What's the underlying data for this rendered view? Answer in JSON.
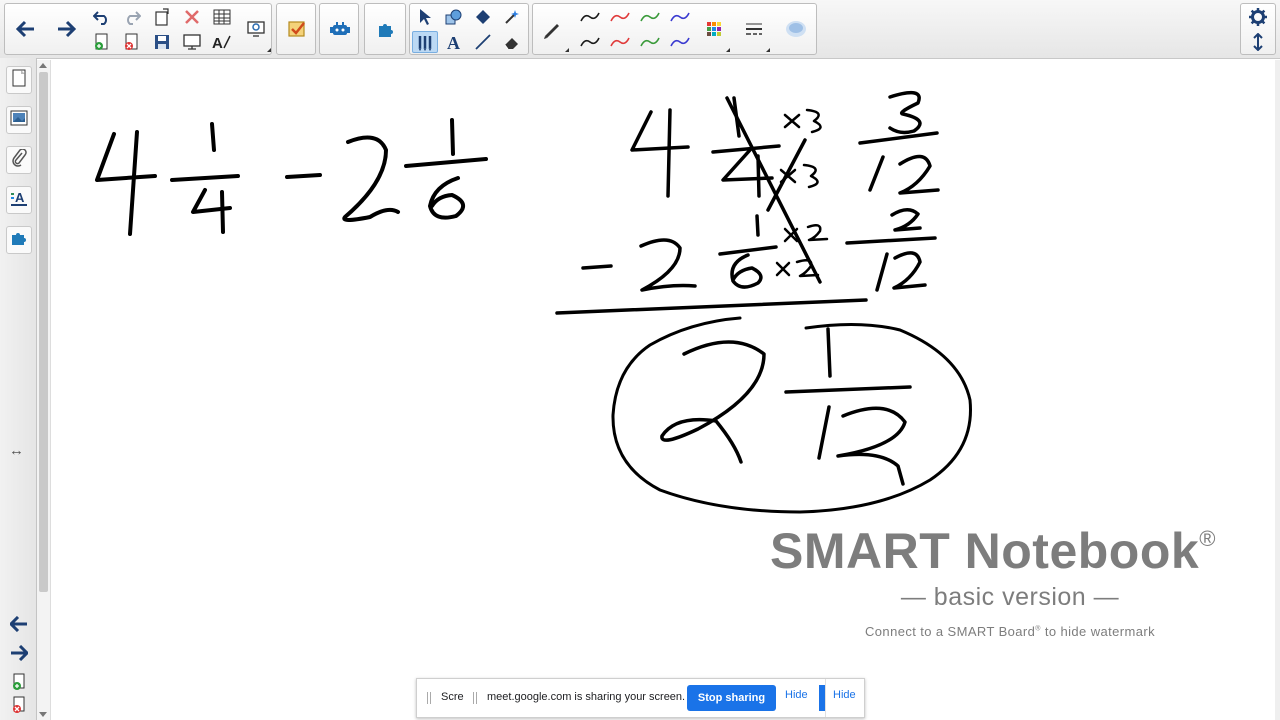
{
  "app": {
    "name": "SMART Notebook",
    "accent": "#1a73e8",
    "ink_color": "#000000"
  },
  "toolbar": {
    "icons": [
      "back-arrow-icon",
      "forward-arrow-icon",
      "undo-icon",
      "redo-icon",
      "new-page-icon",
      "delete-icon",
      "table-icon",
      "add-page-icon",
      "delete-page-icon",
      "save-icon",
      "screen-shade-icon",
      "handwriting-recognition-icon",
      "capture-icon",
      "response-icon",
      "add-on-icon",
      "lab-icon",
      "select-icon",
      "shape-icon",
      "fill-icon",
      "magic-pen-icon",
      "pen-tool-icon",
      "text-icon",
      "line-icon",
      "eraser-icon",
      "pen-icon",
      "color-palette-icon",
      "line-style-icon",
      "properties-icon",
      "settings-gear-icon",
      "toolbar-position-icon"
    ],
    "pen_swatches": [
      "#1a1a1a",
      "#e03a3a",
      "#3a9a3a",
      "#3a3ad0"
    ]
  },
  "sidebar": {
    "icons": [
      "page-sorter-icon",
      "gallery-icon",
      "attachments-icon",
      "properties-icon",
      "add-ons-icon"
    ],
    "bottom_icons": [
      "previous-page-icon",
      "next-page-icon",
      "add-page-icon",
      "delete-page-icon"
    ],
    "resize_glyph": "↔"
  },
  "watermark": {
    "title": "SMART Notebook",
    "registered": "®",
    "subtitle": "— basic version —",
    "note_before": "Connect to a SMART Board",
    "note_reg": "®",
    "note_after": " to hide watermark"
  },
  "share_bar": {
    "underlying_text": "Scre",
    "message": "meet.google.com is sharing your screen.",
    "stop_label": "Stop sharing",
    "hide_label": "Hide",
    "hide_label_behind": "Hide"
  }
}
